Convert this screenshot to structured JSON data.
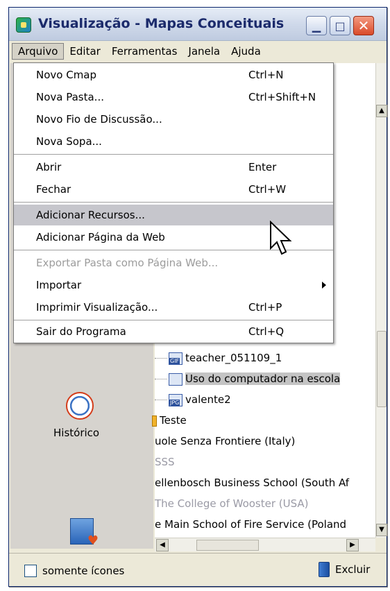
{
  "window": {
    "title": "Visualização - Mapas Conceituais"
  },
  "menubar": [
    "Arquivo",
    "Editar",
    "Ferramentas",
    "Janela",
    "Ajuda"
  ],
  "menu": {
    "items": [
      {
        "label": "Novo Cmap",
        "shortcut": "Ctrl+N"
      },
      {
        "label": "Nova Pasta...",
        "shortcut": "Ctrl+Shift+N"
      },
      {
        "label": "Novo Fio de Discussão...",
        "shortcut": ""
      },
      {
        "label": "Nova Sopa...",
        "shortcut": ""
      },
      {
        "label": "Abrir",
        "shortcut": "Enter"
      },
      {
        "label": "Fechar",
        "shortcut": "Ctrl+W"
      },
      {
        "label": "Adicionar Recursos...",
        "shortcut": ""
      },
      {
        "label": "Adicionar Página da Web",
        "shortcut": ""
      },
      {
        "label": "Exportar Pasta como Página Web...",
        "shortcut": ""
      },
      {
        "label": "Importar",
        "shortcut": ""
      },
      {
        "label": "Imprimir Visualização...",
        "shortcut": "Ctrl+P"
      },
      {
        "label": "Sair do Programa",
        "shortcut": "Ctrl+Q"
      }
    ]
  },
  "tree": [
    {
      "label": "teacher_051109_1",
      "type": "GIF"
    },
    {
      "label": "Uso do computador na escola",
      "type": "map"
    },
    {
      "label": "valente2",
      "type": "JPG"
    },
    {
      "label": "Teste",
      "type": "folder"
    },
    {
      "label": "uole Senza Frontiere (Italy)",
      "type": "text"
    },
    {
      "label": "SSS",
      "type": "text"
    },
    {
      "label": "ellenbosch Business School (South Af",
      "type": "text"
    },
    {
      "label": "The College of Wooster (USA)",
      "type": "text"
    },
    {
      "label": "e Main School of Fire Service (Poland",
      "type": "text"
    }
  ],
  "leftpane": {
    "historico": "Histórico"
  },
  "status": {
    "checkbox": "somente ícones",
    "delete": "Excluir"
  }
}
